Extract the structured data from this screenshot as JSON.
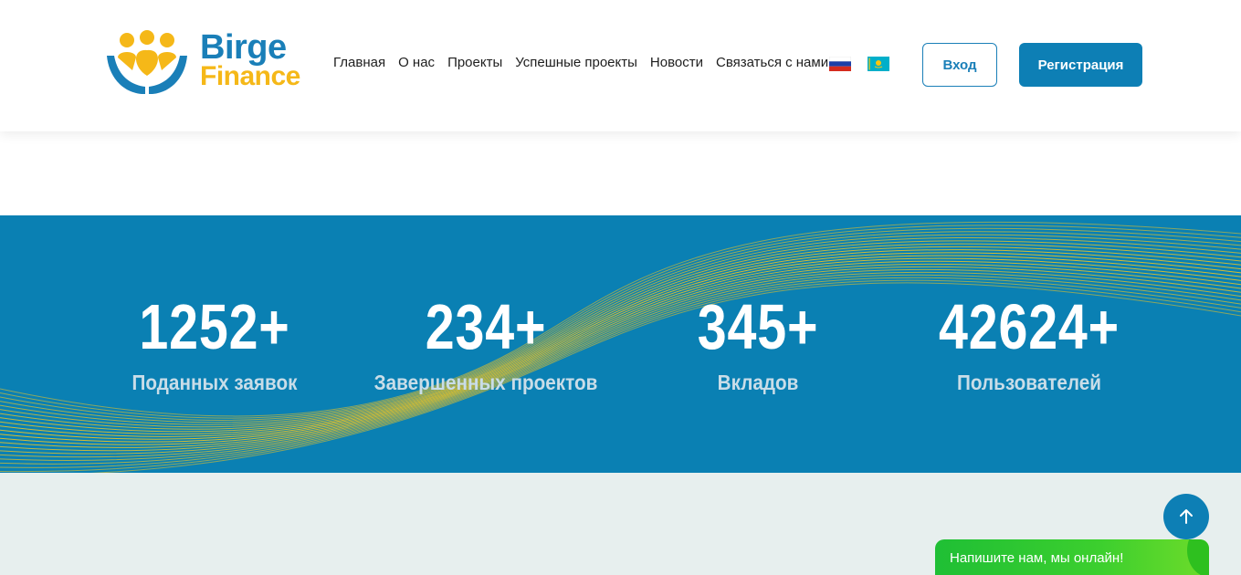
{
  "brand": {
    "name_line1": "Birge",
    "name_line2": "Finance",
    "blue": "#1a7fb8",
    "yellow": "#f5b818"
  },
  "nav": {
    "items": [
      "Главная",
      "О нас",
      "Проекты",
      "Успешные проекты",
      "Новости",
      "Связаться с нами"
    ]
  },
  "languages": [
    {
      "code": "ru",
      "icon": "russia-flag-icon"
    },
    {
      "code": "kz",
      "icon": "kazakhstan-flag-icon"
    }
  ],
  "auth": {
    "login_label": "Вход",
    "register_label": "Регистрация"
  },
  "stats": [
    {
      "value": "1252+",
      "label": "Поданных заявок"
    },
    {
      "value": "234+",
      "label": "Завершенных проектов"
    },
    {
      "value": "345+",
      "label": "Вкладов"
    },
    {
      "value": "42624+",
      "label": "Пользователей"
    }
  ],
  "stats_band": {
    "background": "#0a80b3",
    "wave_color": "#f5c51e"
  },
  "bottom": {
    "background": "#e7efee"
  },
  "scroll_top": {
    "icon": "arrow-up-icon"
  },
  "chat": {
    "label": "Напишите нам, мы онлайн!",
    "color": "#2ec01f"
  }
}
